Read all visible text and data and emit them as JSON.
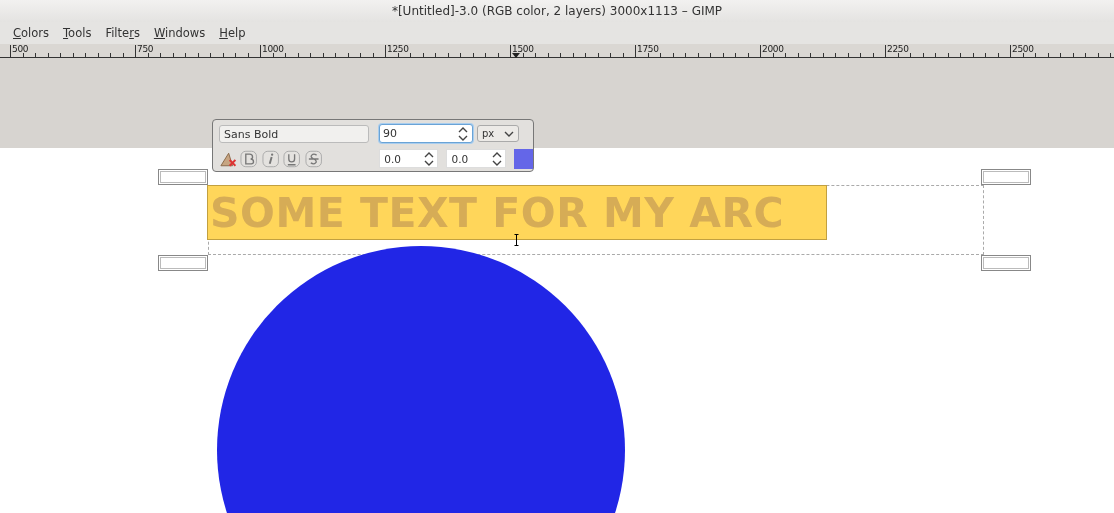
{
  "window": {
    "title": "*[Untitled]-3.0 (RGB color, 2 layers) 3000x1113 – GIMP"
  },
  "menu": [
    {
      "label": "Colors"
    },
    {
      "label": "Tools"
    },
    {
      "label": "Filters"
    },
    {
      "label": "Windows"
    },
    {
      "label": "Help"
    }
  ],
  "ruler": {
    "labels": [
      "500",
      "750",
      "1000",
      "1250",
      "1500",
      "1750",
      "2000",
      "2250",
      "2500"
    ]
  },
  "text_toolbar": {
    "font": "Sans Bold",
    "size": "90",
    "unit": "px",
    "baseline": "0.0",
    "kerning": "0.0",
    "color": "#6466e8"
  },
  "text_layer": {
    "text": "SOME TEXT FOR MY ARC"
  },
  "shape": {
    "kind": "circle",
    "color": "#2126e6"
  }
}
